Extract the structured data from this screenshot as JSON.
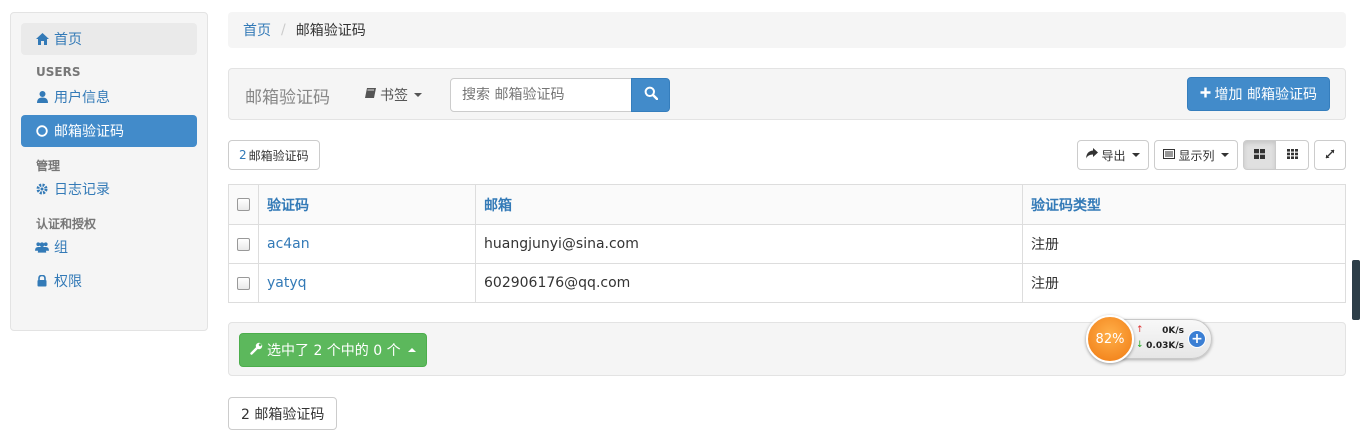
{
  "sidebar": {
    "home": "首页",
    "section_users": "USERS",
    "user_info": "用户信息",
    "email_code": "邮箱验证码",
    "section_manage": "管理",
    "logs": "日志记录",
    "section_auth": "认证和授权",
    "groups": "组",
    "permissions": "权限"
  },
  "breadcrumb": {
    "home": "首页",
    "sep": "/",
    "current": "邮箱验证码"
  },
  "header": {
    "title": "邮箱验证码",
    "bookmarks": "书签",
    "search_placeholder": "搜索 邮箱验证码",
    "add_button": "增加 邮箱验证码"
  },
  "toolbar": {
    "count_num": "2",
    "count_label": "邮箱验证码",
    "export": "导出",
    "columns": "显示列"
  },
  "table": {
    "columns": [
      "验证码",
      "邮箱",
      "验证码类型"
    ],
    "rows": [
      {
        "code": "ac4an",
        "email": "huangjunyi@sina.com",
        "type": "注册"
      },
      {
        "code": "yatyq",
        "email": "602906176@qq.com",
        "type": "注册"
      }
    ]
  },
  "bulk": {
    "label": "选中了 2 个中的 0 个"
  },
  "footer_count": "2 邮箱验证码",
  "net_widget": {
    "percent": "82%",
    "up": "0K/s",
    "down": "0.03K/s"
  },
  "colors": {
    "primary": "#428bca",
    "success": "#5cb85c",
    "link": "#337ab7"
  }
}
